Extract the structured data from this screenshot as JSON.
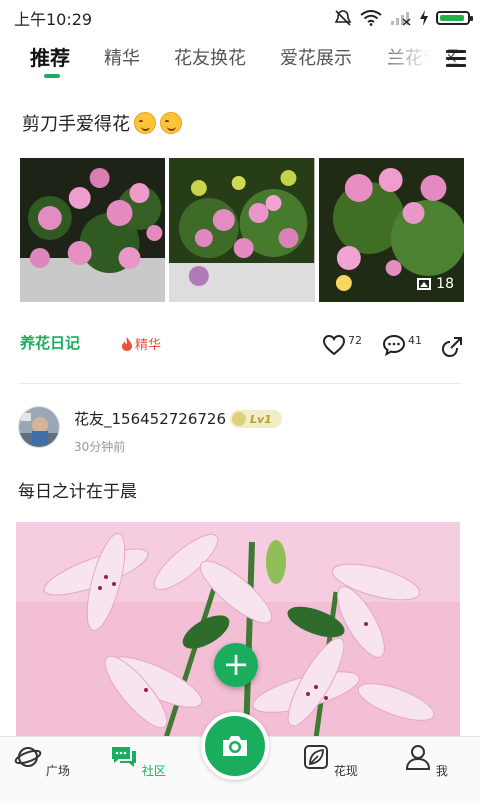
{
  "status_bar": {
    "time": "上午10:29"
  },
  "tabs": [
    {
      "label": "推荐",
      "active": true
    },
    {
      "label": "精华",
      "active": false
    },
    {
      "label": "花友换花",
      "active": false
    },
    {
      "label": "爱花展示",
      "active": false
    },
    {
      "label": "兰花专区",
      "active": false
    }
  ],
  "post1": {
    "title": "剪刀手爱得花",
    "photo_count": "18",
    "topic": "养花日记",
    "essence_label": "精华",
    "likes": "72",
    "comments": "41"
  },
  "post2": {
    "username": "花友_156452726726",
    "level": "Lv1",
    "time": "30分钟前",
    "text": "每日之计在于晨"
  },
  "bottom_nav": [
    {
      "label": "广场",
      "icon": "planet-icon",
      "active": false
    },
    {
      "label": "社区",
      "icon": "chat-icon",
      "active": true
    },
    {
      "label": "花现",
      "icon": "leaf-icon",
      "active": false
    },
    {
      "label": "我",
      "icon": "person-icon",
      "active": false
    }
  ],
  "colors": {
    "accent": "#1aad5d",
    "essence": "#e8553a",
    "level_badge": "#f1edc4"
  }
}
